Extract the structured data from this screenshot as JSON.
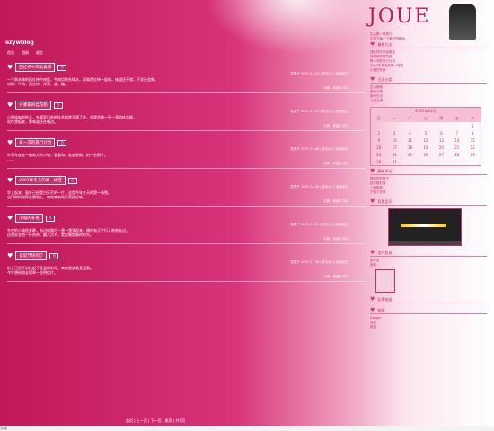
{
  "blog": {
    "name": "ezywblog",
    "logo": "JOUE"
  },
  "nav": [
    "首页",
    "相册",
    "留言"
  ],
  "posts": [
    {
      "title": "西红柿牛肉饭做法",
      "tag": "日",
      "meta": "发表于 2007-12-12 | 评论(0) | 阅读全文",
      "body": [
        "一个周末做的西红柿牛肉饭，牛肉切块先焯水，再和西红柿一起炖，味道还不错，下次还会做。",
        "材料：牛肉、西红柿、洋葱、盐、糖。"
      ],
      "foot": "引用 | 收藏 | 评论"
    },
    {
      "title": "外婆家的桂花糕",
      "tag": "日",
      "meta": "发表于 2007-12-10 | 评论(0) | 阅读全文",
      "body": [
        "小时候每到秋天，外婆家门前的桂花树就开满了花，外婆会做一笼一笼的桂花糕。",
        "现在想起来，那味道还在嘴边。"
      ],
      "foot": "引用 | 收藏 | 评论"
    },
    {
      "title": "再一次的旅行计划",
      "tag": "日",
      "meta": "发表于 2007-12-08 | 评论(0) | 阅读全文",
      "body": [
        "计划年底去一趟南方的小城，看看海，走走老街，拍一些照片。",
        "……"
      ],
      "foot": "引用 | 收藏 | 评论"
    },
    {
      "title": "2007年冬天的第一场雪",
      "tag": "日",
      "meta": "发表于 2007-12-05 | 评论(0) | 阅读全文",
      "body": [
        "早上起来，窗外已经是白茫茫的一片，这是今年冬天的第一场雪。",
        "出门的时候踩在雪地上，咯吱咯吱的声音很好听。"
      ],
      "foot": "引用 | 收藏 | 评论"
    },
    {
      "title": "小城的冬夜",
      "tag": "日",
      "meta": "发表于 2007-12-01 | 评论(0) | 阅读全文",
      "body": [
        "冬夜的小城很安静，街边的路灯一盏一盏亮起来，偶尔有几个行人匆匆走过。",
        "回到家里泡一杯热茶，翻几页书，就是最舒服的时光。"
      ],
      "foot": "引用 | 收藏 | 评论"
    },
    {
      "title": "圣诞节快到了",
      "tag": "日",
      "meta": "发表于 2007-11-28 | 评论(0) | 阅读全文",
      "body": [
        "街上已经开始挂起了圣诞的彩灯，商店里放着圣诞歌。",
        "今年想给朋友们寄一些明信片。"
      ],
      "foot": "引用 | 收藏 | 评论"
    }
  ],
  "sidebar": {
    "intro": [
      "生活是一场旅行，",
      "记录下每一个美好的瞬间。"
    ],
    "boxes": [
      {
        "title": "最新日志",
        "items": [
          "西红柿牛肉饭做法",
          "外婆家的桂花糕",
          "再一次的旅行计划",
          "2007年冬天的第一场雪",
          "小城的冬夜"
        ]
      },
      {
        "title": "日志分类",
        "items": [
          "生活随笔",
          "美食记录",
          "旅行日记",
          "心情点滴"
        ]
      }
    ],
    "calendar": {
      "title": "2007年12月",
      "head": [
        "日",
        "一",
        "二",
        "三",
        "四",
        "五",
        "六"
      ],
      "rows": [
        [
          "",
          "",
          "",
          "",
          "",
          "",
          "1"
        ],
        [
          "2",
          "3",
          "4",
          "5",
          "6",
          "7",
          "8"
        ],
        [
          "9",
          "10",
          "11",
          "12",
          "13",
          "14",
          "15"
        ],
        [
          "16",
          "17",
          "18",
          "19",
          "20",
          "21",
          "22"
        ],
        [
          "23",
          "24",
          "25",
          "26",
          "27",
          "28",
          "29"
        ],
        [
          "30",
          "31",
          "",
          "",
          "",
          "",
          ""
        ]
      ]
    },
    "comments_title": "最新评论",
    "comments": [
      "很好吃的样子",
      "桂花糕好香",
      "一路顺风",
      "下雪了好美"
    ],
    "music_title": "背景音乐",
    "users_title": "用户登录",
    "users": [
      "用户名",
      "密码"
    ],
    "friends_title": "友情链接",
    "links_title": "链接",
    "links": [
      "Google",
      "百度",
      "新浪"
    ]
  },
  "footer": "首页 | 上一页 | 下一页 | 尾页 | 共1页",
  "status": "完成"
}
